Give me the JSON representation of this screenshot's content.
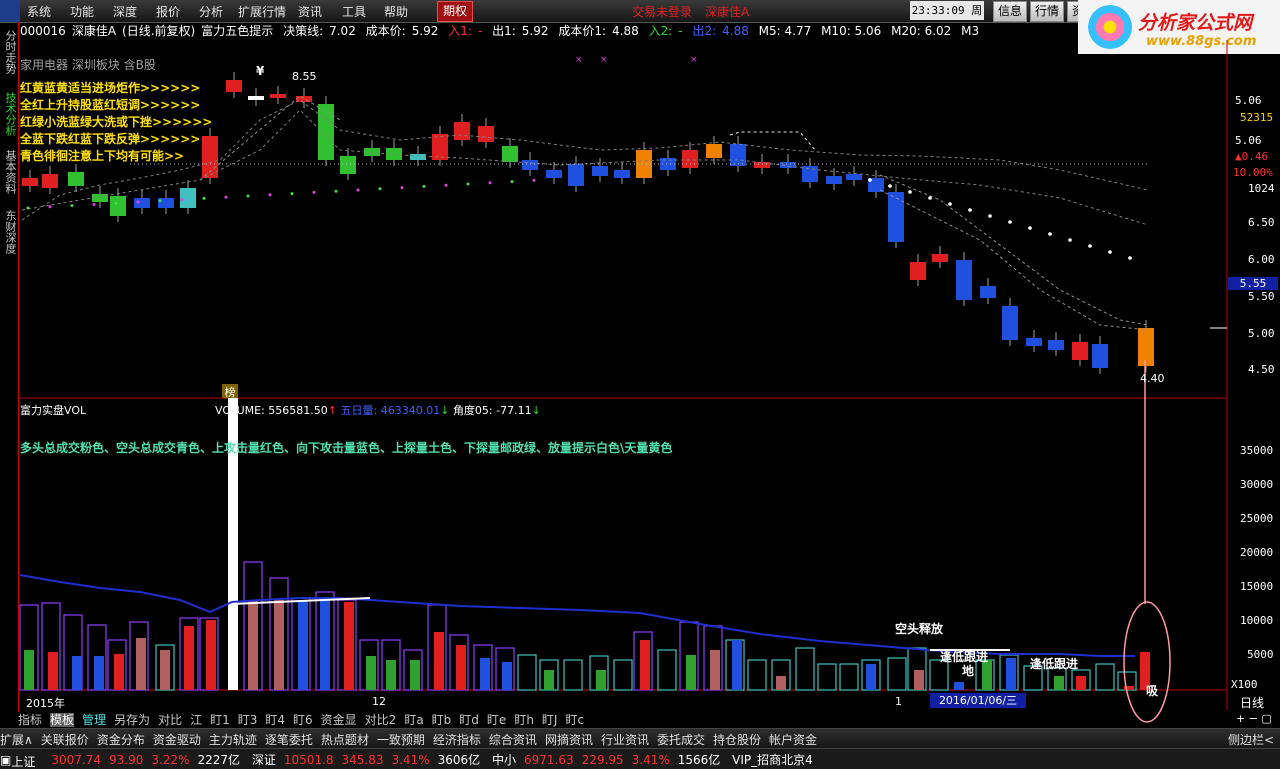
{
  "menu": {
    "items": [
      "系统",
      "功能",
      "深度",
      "报价",
      "分析",
      "扩展行情",
      "资讯",
      "工具",
      "帮助"
    ],
    "qiquan": "期权",
    "login": "交易未登录",
    "stock_tab": "深康佳A",
    "clock": "23:33:09",
    "weekday": "周二",
    "buttons": [
      "信息",
      "行情",
      "资"
    ]
  },
  "brand": {
    "name": "分析家公式网",
    "url": "www.88gs.com"
  },
  "info": {
    "code": "000016",
    "name": "深康佳A",
    "period": "(日线.前复权)",
    "indicator": "富力五色提示",
    "decision_label": "决策线:",
    "decision_val": "7.02",
    "cost1_label": "成本价:",
    "cost1_val": "5.92",
    "in1_label": "入1:",
    "in1_val": "-",
    "out1_label": "出1:",
    "out1_val": "5.92",
    "cost2_label": "成本价1:",
    "cost2_val": "4.88",
    "in2_label": "入2:",
    "in2_val": "-",
    "out2_label": "出2:",
    "out2_val": "4.88",
    "m5": "M5: 4.77",
    "m10": "M10: 5.06",
    "m20": "M20: 6.02",
    "m30": "M3"
  },
  "sidebar": {
    "tabs": [
      "分时走势",
      "技术分析",
      "基本资料",
      "东财深度"
    ]
  },
  "main": {
    "tags": "家用电器  深圳板块  含B股",
    "legend": [
      "红黄蓝黄适当进场炬作>>>>>>",
      "全红上升持股蓝红短调>>>>>>",
      "红绿小洗蓝绿大洗或下挫>>>>>>",
      "全蓝下跌红蓝下跌反弹>>>>>>",
      "青色徘徊注意上下均有可能>>"
    ],
    "label_high": "8.55",
    "label_low": "4.40",
    "yen": "¥",
    "bang": "榜"
  },
  "price_axis": {
    "ticks": [
      "5.06",
      "52315",
      "5.06",
      "0.46",
      "10.00%",
      "1024",
      "6.50",
      "6.00",
      "5.50",
      "5.55",
      "5.00",
      "4.50"
    ]
  },
  "vol": {
    "title": "富力实盘VOL",
    "volume_label": "VOLUME:",
    "volume_val": "556581.50",
    "five_label": "五日量:",
    "five_val": "463340.01",
    "angle_label": "角度05:",
    "angle_val": "-77.11",
    "legend": "多头总成交粉色、空头总成交青色、上攻击量红色、向下攻击量蓝色、上探量土色、下探量邮政绿、放量提示白色\\天量黄色",
    "ticks": [
      "35000",
      "30000",
      "25000",
      "20000",
      "15000",
      "10000",
      "5000",
      "X100"
    ],
    "notes": {
      "kongtou": "空头释放",
      "dixi1": "逢低跟进",
      "di": "地",
      "dixi2": "逢低跟进",
      "xi": "吸"
    }
  },
  "dates": {
    "y2015": "2015年",
    "m12": "12",
    "m1": "1",
    "cursor": "2016/01/06/三",
    "period": "日线"
  },
  "tabs": [
    "指标",
    "模板",
    "管理",
    "另存为",
    "对比",
    "江",
    "盯1",
    "盯3",
    "盯4",
    "盯6",
    "资金显",
    "对比2",
    "盯a",
    "盯b",
    "盯d",
    "盯e",
    "盯h",
    "盯J",
    "盯c"
  ],
  "functions": [
    "扩展∧",
    "关联报价",
    "资金分布",
    "资金驱动",
    "主力轨迹",
    "逐笔委托",
    "热点题材",
    "一致预期",
    "经济指标",
    "综合资讯",
    "网摘资讯",
    "行业资讯",
    "委托成交",
    "持仓股份",
    "帐户资金",
    "侧边栏<"
  ],
  "status": {
    "sh_label": "上证",
    "sh_val": "3007.74",
    "sh_chg": "93.90",
    "sh_pct": "3.22%",
    "sh_amt": "2227亿",
    "sz_label": "深证",
    "sz_val": "10501.8",
    "sz_chg": "345.83",
    "sz_pct": "3.41%",
    "sz_amt": "3606亿",
    "zx_label": "中小",
    "zx_val": "6971.63",
    "zx_chg": "229.95",
    "zx_pct": "3.41%",
    "zx_amt": "1566亿",
    "vip": "VIP_招商北京4"
  },
  "colors": {
    "up": "#ff3030",
    "down": "#30d830",
    "blue": "#2030ff",
    "yellow": "#ffd000",
    "cyan": "#50e0e0"
  }
}
